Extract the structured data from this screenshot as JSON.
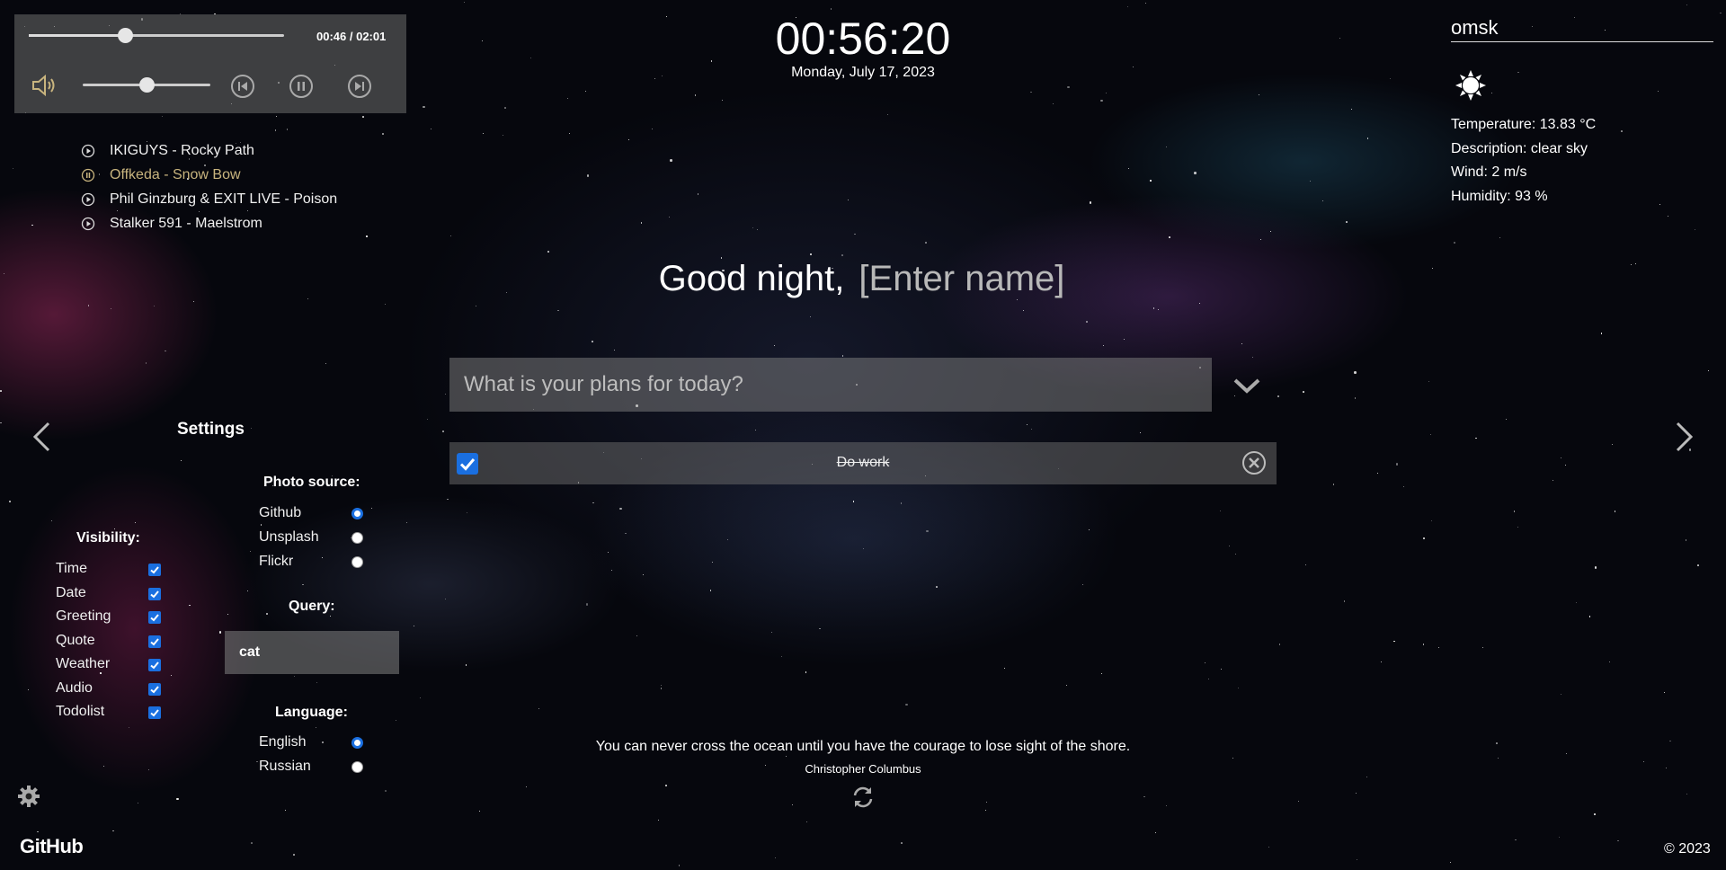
{
  "player": {
    "time": "00:46 / 02:01",
    "progress_fraction": 0.38,
    "volume_fraction": 0.5,
    "icons": {
      "volume": "volume-icon",
      "prev": "previous-icon",
      "pause": "pause-icon",
      "next": "next-icon"
    },
    "playlist": [
      {
        "title": "IKIGUYS - Rocky Path",
        "state": "play"
      },
      {
        "title": "Offkeda - Snow Bow",
        "state": "pause"
      },
      {
        "title": "Phil Ginzburg & EXIT LIVE - Poison",
        "state": "play"
      },
      {
        "title": "Stalker 591 - Maelstrom",
        "state": "play"
      }
    ]
  },
  "clock": {
    "time": "00:56:20",
    "date": "Monday, July 17, 2023"
  },
  "weather": {
    "city": "omsk",
    "icon": "clear-sky-icon",
    "temperature": "Temperature: 13.83 °C",
    "description": "Description: clear sky",
    "wind": "Wind: 2 m/s",
    "humidity": "Humidity: 93 %"
  },
  "greeting": {
    "text": "Good night,",
    "name_placeholder": "[Enter name]"
  },
  "todo": {
    "placeholder": "What is your plans for today?",
    "items": [
      {
        "text": "Do work",
        "done": true
      }
    ]
  },
  "settings": {
    "title": "Settings",
    "photo_source": {
      "title": "Photo source:",
      "options": [
        "Github",
        "Unsplash",
        "Flickr"
      ],
      "selected": "Github"
    },
    "visibility": {
      "title": "Visibility:",
      "items": [
        "Time",
        "Date",
        "Greeting",
        "Quote",
        "Weather",
        "Audio",
        "Todolist"
      ]
    },
    "query": {
      "title": "Query:",
      "value": "cat"
    },
    "language": {
      "title": "Language:",
      "options": [
        "English",
        "Russian"
      ],
      "selected": "English"
    }
  },
  "quote": {
    "text": "You can never cross the ocean until you have the courage to lose sight of the shore.",
    "author": "Christopher Columbus"
  },
  "footer": {
    "github": "GitHub",
    "copyright": "© 2023"
  },
  "colors": {
    "accent": "#1a6fe0",
    "active_track": "#c8b47e",
    "panel": "rgba(110,110,110,0.55)"
  }
}
